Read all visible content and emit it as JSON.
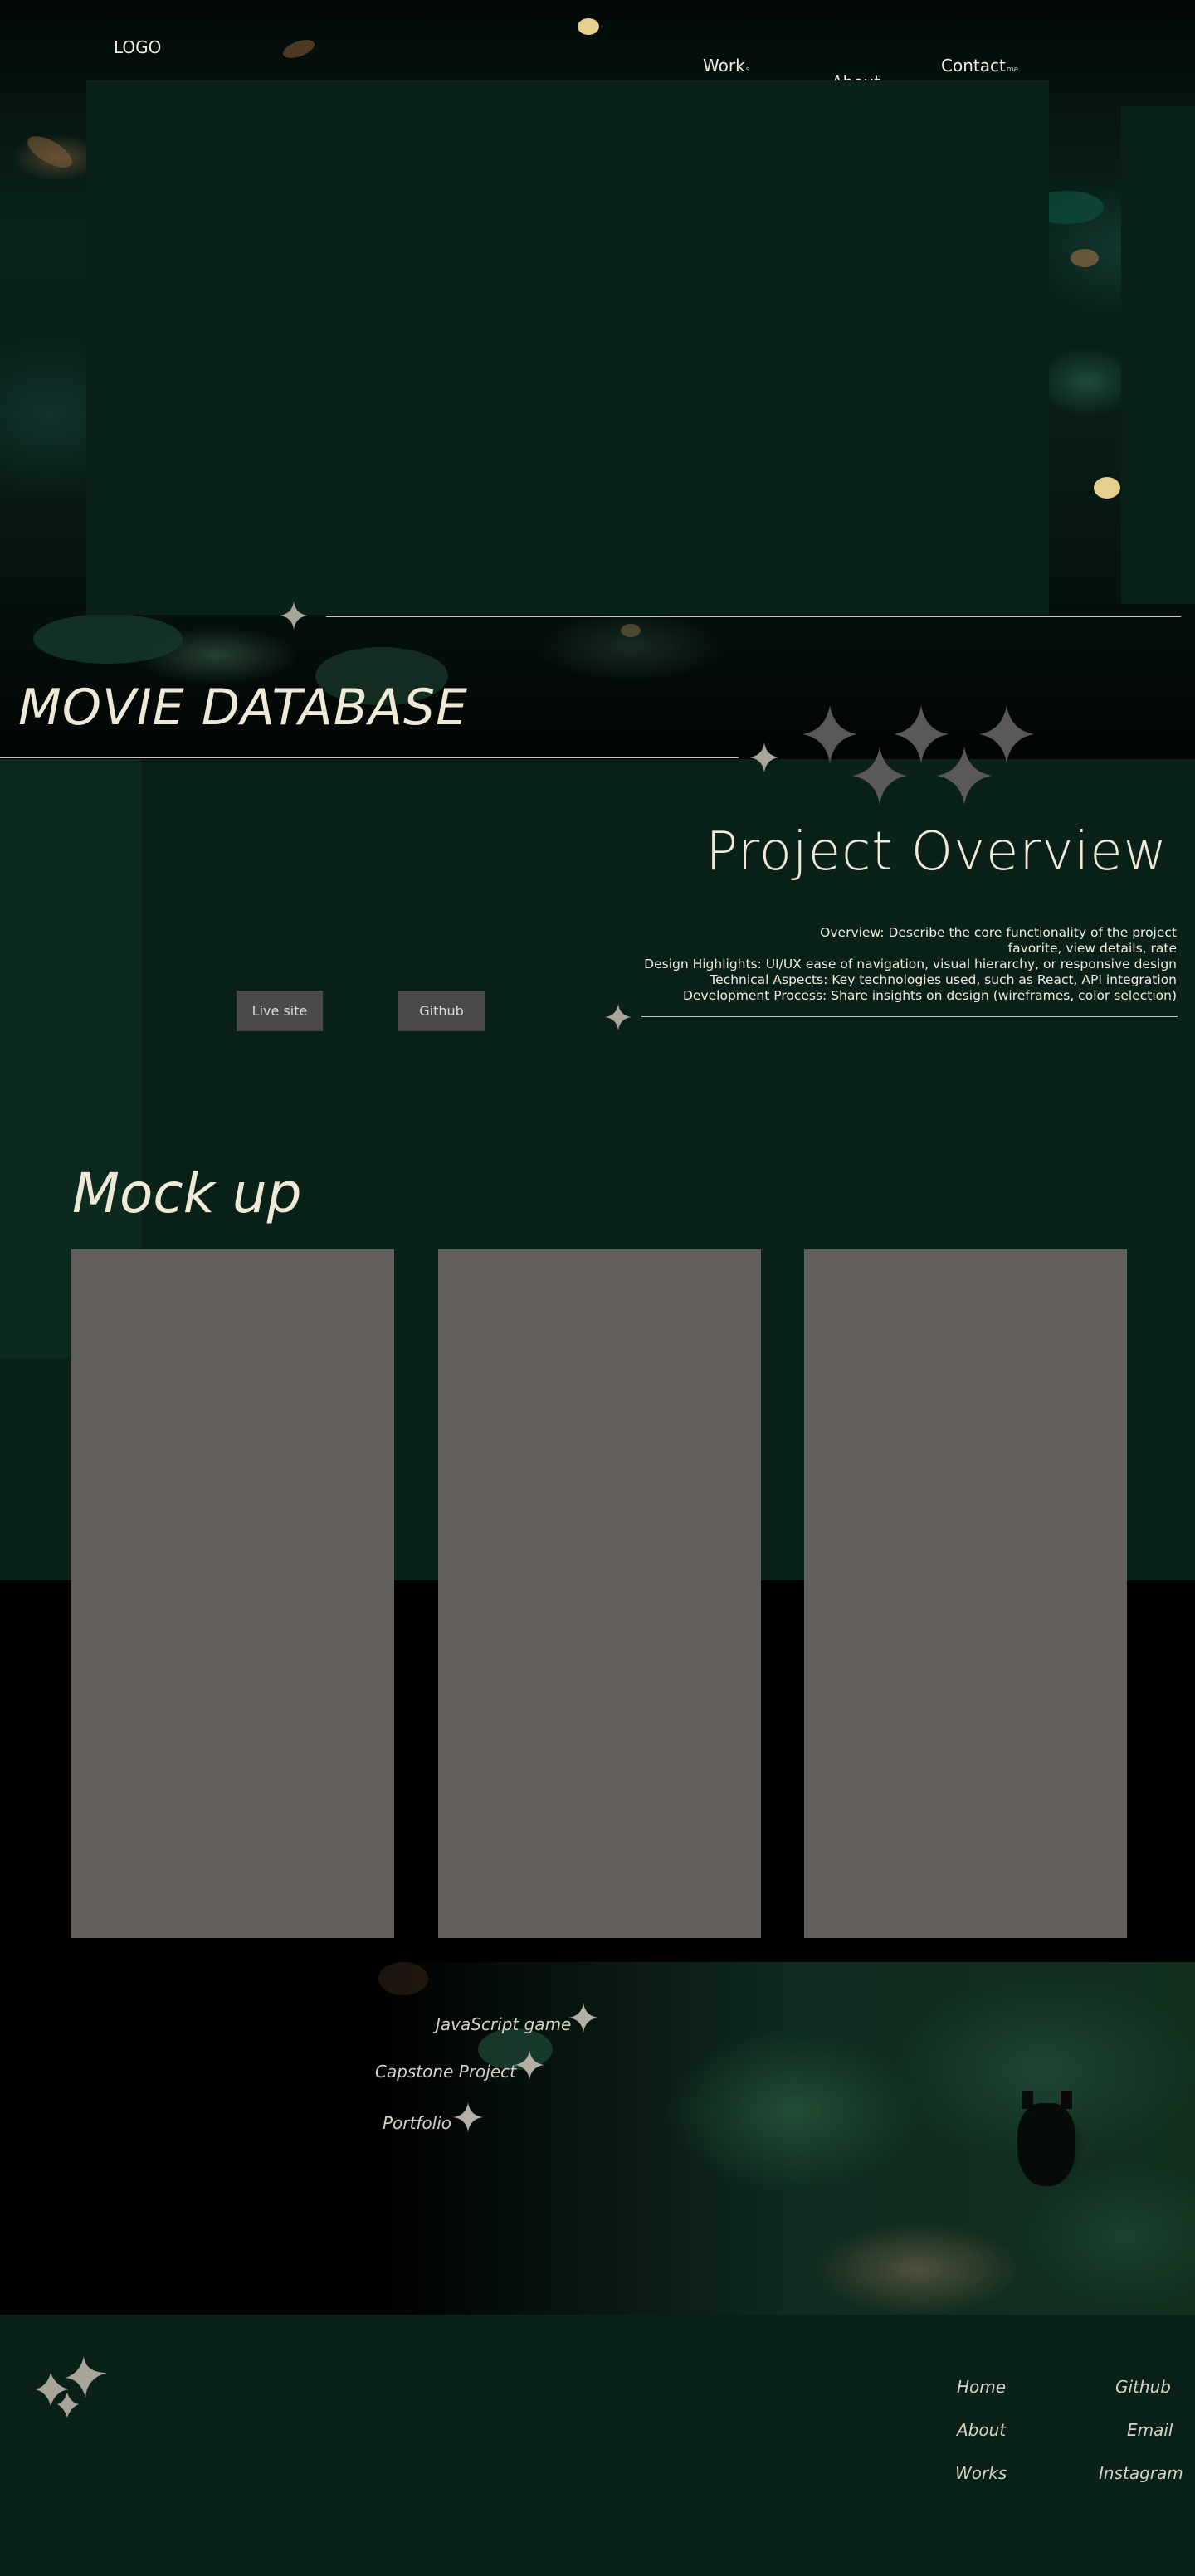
{
  "header": {
    "logo": "LOGO",
    "nav": [
      {
        "label": "Work",
        "suffix": "s"
      },
      {
        "label": "About",
        "suffix": "me"
      },
      {
        "label": "Contact",
        "suffix": "me"
      }
    ]
  },
  "hero": {
    "project_title": "MOVIE DATABASE"
  },
  "overview": {
    "title": "Project Overview",
    "lines": [
      "Overview: Describe the core functionality of the project",
      "favorite, view details, rate",
      "Design Highlights: UI/UX  ease of navigation, visual hierarchy, or responsive design",
      "Technical Aspects: Key technologies used, such as React, API integration",
      "Development Process: Share insights on design (wireframes, color selection)"
    ],
    "buttons": {
      "live_site": "Live site",
      "github": "Github"
    }
  },
  "mockup": {
    "title": "Mock up"
  },
  "projects": {
    "items": [
      "JavaScript game",
      "Capstone Project",
      "Portfolio"
    ]
  },
  "footer": {
    "col1": [
      "Home",
      "About",
      "Works"
    ],
    "col2": [
      "Github",
      "Email",
      "Instagram"
    ]
  },
  "colors": {
    "dark_green": "#0a2119",
    "cream": "#efe9d8",
    "star_grey": "#a9a49c",
    "mock_grey": "#625f5c"
  },
  "icons": [
    "star-icon",
    "sparkle-cluster-icon",
    "sparkle-logo-icon"
  ]
}
